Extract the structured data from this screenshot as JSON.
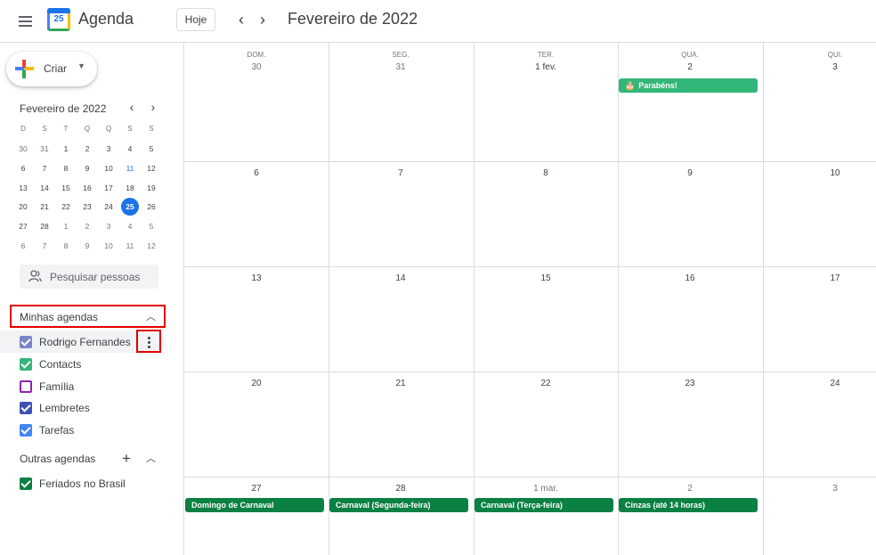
{
  "header": {
    "app_title": "Agenda",
    "logo_day": "25",
    "today_label": "Hoje",
    "period_title": "Fevereiro de 2022"
  },
  "sidebar": {
    "create_label": "Criar",
    "mini_calendar": {
      "title": "Fevereiro de 2022",
      "weekday_headers": [
        "D",
        "S",
        "T",
        "Q",
        "Q",
        "S",
        "S"
      ],
      "weeks": [
        [
          "30",
          "31",
          "1",
          "2",
          "3",
          "4",
          "5"
        ],
        [
          "6",
          "7",
          "8",
          "9",
          "10",
          "11",
          "12"
        ],
        [
          "13",
          "14",
          "15",
          "16",
          "17",
          "18",
          "19"
        ],
        [
          "20",
          "21",
          "22",
          "23",
          "24",
          "25",
          "26"
        ],
        [
          "27",
          "28",
          "1",
          "2",
          "3",
          "4",
          "5"
        ],
        [
          "6",
          "7",
          "8",
          "9",
          "10",
          "11",
          "12"
        ]
      ],
      "today": "25"
    },
    "search_people_placeholder": "Pesquisar pessoas",
    "my_calendars": {
      "title": "Minhas agendas",
      "items": [
        {
          "label": "Rodrigo Fernandes",
          "color": "#7986cb",
          "checked": true
        },
        {
          "label": "Contacts",
          "color": "#33b679",
          "checked": true
        },
        {
          "label": "Família",
          "color": "#8e24aa",
          "checked": false
        },
        {
          "label": "Lembretes",
          "color": "#3f51b5",
          "checked": true
        },
        {
          "label": "Tarefas",
          "color": "#4285f4",
          "checked": true
        }
      ]
    },
    "other_calendars": {
      "title": "Outras agendas",
      "items": [
        {
          "label": "Feriados no Brasil",
          "color": "#0b8043",
          "checked": true
        }
      ]
    }
  },
  "calendar": {
    "weekdays": [
      "DOM.",
      "SEG.",
      "TER.",
      "QUA.",
      "QUI."
    ],
    "weeks": [
      [
        "30",
        "31",
        "1 fev.",
        "2",
        "3"
      ],
      [
        "6",
        "7",
        "8",
        "9",
        "10"
      ],
      [
        "13",
        "14",
        "15",
        "16",
        "17"
      ],
      [
        "20",
        "21",
        "22",
        "23",
        "24"
      ],
      [
        "27",
        "28",
        "1 mar.",
        "2",
        "3"
      ]
    ],
    "events": [
      {
        "label": "Parabéns!",
        "color": "#33b679"
      },
      {
        "label": "Domingo de Carnaval",
        "color": "#0b8043"
      },
      {
        "label": "Carnaval (Segunda-feira)",
        "color": "#0b8043"
      },
      {
        "label": "Carnaval (Terça-feira)",
        "color": "#0b8043"
      },
      {
        "label": "Cinzas (até 14 horas)",
        "color": "#0b8043"
      }
    ]
  },
  "colors": {
    "accent": "#1a73e8",
    "highlight_box": "#e00000"
  }
}
